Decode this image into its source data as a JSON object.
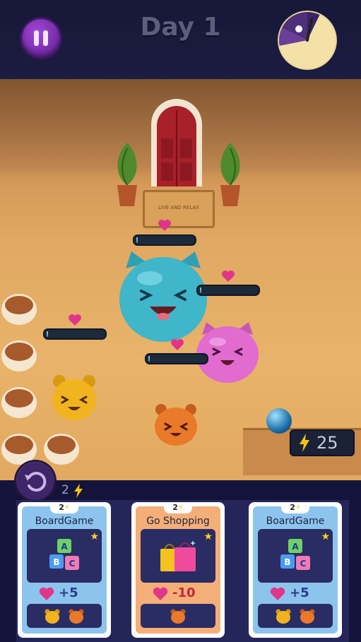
{
  "header": {
    "day_title": "Day 1",
    "pause_icon": "pause-icon",
    "clock_icon": "day-night-clock-icon"
  },
  "room": {
    "sign_text": "LIVE AND RELAX",
    "energy": "25",
    "energy_icon": "lightning-bolt-icon"
  },
  "characters": [
    {
      "name": "blue-cat-blob",
      "color": "#3fb6c9",
      "love_level": 0.0
    },
    {
      "name": "pink-cat-blob",
      "color": "#e26bd0",
      "love_level": 0.0
    },
    {
      "name": "yellow-bear-blob",
      "color": "#f2b41e",
      "love_level": 0.0
    },
    {
      "name": "orange-bear-blob",
      "color": "#e97a2a",
      "love_level": 0.0
    }
  ],
  "undo": {
    "icon": "undo-icon",
    "cost": "2"
  },
  "cards": [
    {
      "cost": "2",
      "title": "BoardGame",
      "effect": "+5",
      "art": "abc-blocks-icon",
      "theme": "blue"
    },
    {
      "cost": "2",
      "title": "Go Shopping",
      "effect": "-10",
      "art": "shopping-bags-icon",
      "theme": "orange"
    },
    {
      "cost": "2",
      "title": "BoardGame",
      "effect": "+5",
      "art": "abc-blocks-icon",
      "theme": "blue"
    }
  ],
  "colors": {
    "accent_purple": "#7a2fb8",
    "heart_pink": "#e0368a",
    "card_blue": "#8dc4ee",
    "card_orange": "#f4ae78"
  }
}
